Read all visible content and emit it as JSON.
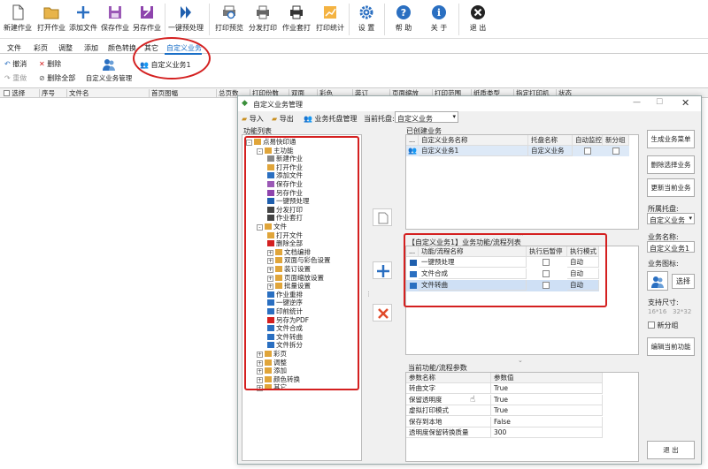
{
  "toolbar": [
    {
      "name": "new-job",
      "label": "新建作业",
      "icon": "file-icon"
    },
    {
      "name": "open-job",
      "label": "打开作业",
      "icon": "folder-icon"
    },
    {
      "name": "add-file",
      "label": "添加文件",
      "icon": "plus-icon"
    },
    {
      "name": "save-job",
      "label": "保存作业",
      "icon": "save-icon"
    },
    {
      "name": "save-as-job",
      "label": "另存作业",
      "icon": "save-as-icon"
    },
    {
      "name": "one-key",
      "label": "一键预处理",
      "icon": "double-chevron-icon"
    },
    {
      "name": "print-preview",
      "label": "打印预览",
      "icon": "preview-icon"
    },
    {
      "name": "split-print",
      "label": "分发打印",
      "icon": "printer-icon"
    },
    {
      "name": "job-stack",
      "label": "作业套打",
      "icon": "printer-icon"
    },
    {
      "name": "print-stats",
      "label": "打印统计",
      "icon": "chart-icon"
    },
    {
      "name": "settings",
      "label": "设  置",
      "icon": "gear-icon"
    },
    {
      "name": "help",
      "label": "帮  助",
      "icon": "help-icon"
    },
    {
      "name": "about",
      "label": "关  于",
      "icon": "info-icon"
    },
    {
      "name": "exit",
      "label": "退  出",
      "icon": "close-icon"
    }
  ],
  "menu_tabs": [
    "文件",
    "彩页",
    "调整",
    "添加",
    "颜色转换",
    "其它",
    "自定义业务"
  ],
  "ribbon": {
    "cancel": "撤消",
    "redo": "重做",
    "delete": "删除",
    "delete_all": "删除全部",
    "custom_mgmt": "自定义业务管理",
    "custom_task": "自定义业务1"
  },
  "grid_headers": [
    "选择",
    "序号",
    "文件名",
    "首页图幅",
    "总页数",
    "打印份数",
    "双面",
    "彩色",
    "装订",
    "页面缩放",
    "打印范围",
    "纸质类型",
    "指定打印机",
    "状态"
  ],
  "dialog": {
    "title": "自定义业务管理",
    "toolbar": {
      "import": "导入",
      "export": "导出",
      "tray_mgmt": "业务托盘管理",
      "current_tray_label": "当前托盘:",
      "current_tray_value": "自定义业务"
    },
    "func_list_title": "功能列表",
    "tree": [
      {
        "level": 0,
        "label": "点易快印通",
        "exp": "-",
        "icon": "folder-icon"
      },
      {
        "level": 1,
        "label": "主功能",
        "exp": "-",
        "icon": "folder-icon"
      },
      {
        "level": 2,
        "label": "新建作业",
        "icon": "file-icon"
      },
      {
        "level": 2,
        "label": "打开作业",
        "icon": "folder-icon"
      },
      {
        "level": 2,
        "label": "添加文件",
        "icon": "plus-icon"
      },
      {
        "level": 2,
        "label": "保存作业",
        "icon": "save-icon"
      },
      {
        "level": 2,
        "label": "另存作业",
        "icon": "save-as-icon"
      },
      {
        "level": 2,
        "label": "一键预处理",
        "icon": "double-chevron-icon"
      },
      {
        "level": 2,
        "label": "分发打印",
        "icon": "printer-icon"
      },
      {
        "level": 2,
        "label": "作业套打",
        "icon": "printer-icon"
      },
      {
        "level": 1,
        "label": "文件",
        "exp": "-",
        "icon": "folder-icon"
      },
      {
        "level": 2,
        "label": "打开文件",
        "icon": "folder-icon"
      },
      {
        "level": 2,
        "label": "删除全部",
        "icon": "delete-icon"
      },
      {
        "level": 2,
        "label": "文档编排",
        "exp": "+",
        "icon": "folder-icon"
      },
      {
        "level": 2,
        "label": "双面与彩色设置",
        "exp": "+",
        "icon": "folder-icon"
      },
      {
        "level": 2,
        "label": "装订设置",
        "exp": "+",
        "icon": "folder-icon"
      },
      {
        "level": 2,
        "label": "页面缩放设置",
        "exp": "+",
        "icon": "folder-icon"
      },
      {
        "level": 2,
        "label": "批量设置",
        "exp": "+",
        "icon": "folder-icon"
      },
      {
        "level": 2,
        "label": "作业重排",
        "icon": "sort-icon"
      },
      {
        "level": 2,
        "label": "一键逆序",
        "icon": "reverse-icon"
      },
      {
        "level": 2,
        "label": "印前统计",
        "icon": "table-icon"
      },
      {
        "level": 2,
        "label": "另存为PDF",
        "icon": "pdf-icon"
      },
      {
        "level": 2,
        "label": "文件合成",
        "icon": "merge-icon"
      },
      {
        "level": 2,
        "label": "文件转曲",
        "icon": "curve-icon"
      },
      {
        "level": 2,
        "label": "文件拆分",
        "icon": "split-icon"
      },
      {
        "level": 1,
        "label": "彩页",
        "exp": "+",
        "icon": "folder-icon"
      },
      {
        "level": 1,
        "label": "调整",
        "exp": "+",
        "icon": "folder-icon"
      },
      {
        "level": 1,
        "label": "添加",
        "exp": "+",
        "icon": "folder-icon"
      },
      {
        "level": 1,
        "label": "颜色转换",
        "exp": "+",
        "icon": "folder-icon"
      },
      {
        "level": 1,
        "label": "其它",
        "exp": "+",
        "icon": "folder-icon"
      }
    ],
    "created_title": "已创建业务",
    "created_headers": [
      "...",
      "自定义业务名称",
      "托盘名称",
      "自动监控",
      "新分组"
    ],
    "created_rows": [
      {
        "name": "自定义业务1",
        "tray": "自定义业务"
      }
    ],
    "flow_title": "【自定义业务1】业务功能/流程列表",
    "flow_headers": [
      "...",
      "功能/流程名称",
      "执行后暂停",
      "执行模式"
    ],
    "flow_rows": [
      {
        "name": "一键预处理",
        "mode": "自动",
        "icon": "double-chevron-icon"
      },
      {
        "name": "文件合成",
        "mode": "自动",
        "icon": "merge-icon"
      },
      {
        "name": "文件转曲",
        "mode": "自动",
        "icon": "curve-icon"
      }
    ],
    "param_title": "当前功能/流程参数",
    "param_headers": [
      "参数名称",
      "参数值"
    ],
    "param_rows": [
      {
        "name": "转曲文字",
        "value": "True"
      },
      {
        "name": "保留透明度",
        "value": "True"
      },
      {
        "name": "虚拟打印模式",
        "value": "True"
      },
      {
        "name": "保存到本地",
        "value": "False"
      },
      {
        "name": "透明度保留转换质量",
        "value": "300"
      }
    ],
    "right": {
      "gen_menu": "生成业务菜单",
      "delete_selected": "删除选择业务",
      "update_current": "更新当前业务",
      "tray_label": "所属托盘:",
      "tray_value": "自定义业务",
      "name_label": "业务名称:",
      "name_value": "自定义业务1",
      "icon_label": "业务图标:",
      "choose": "选择",
      "size_label": "支持尺寸:",
      "sizes": "16*16   32*32",
      "new_group": "新分组",
      "edit_current": "编辑当前功能",
      "exit": "退  出"
    }
  }
}
